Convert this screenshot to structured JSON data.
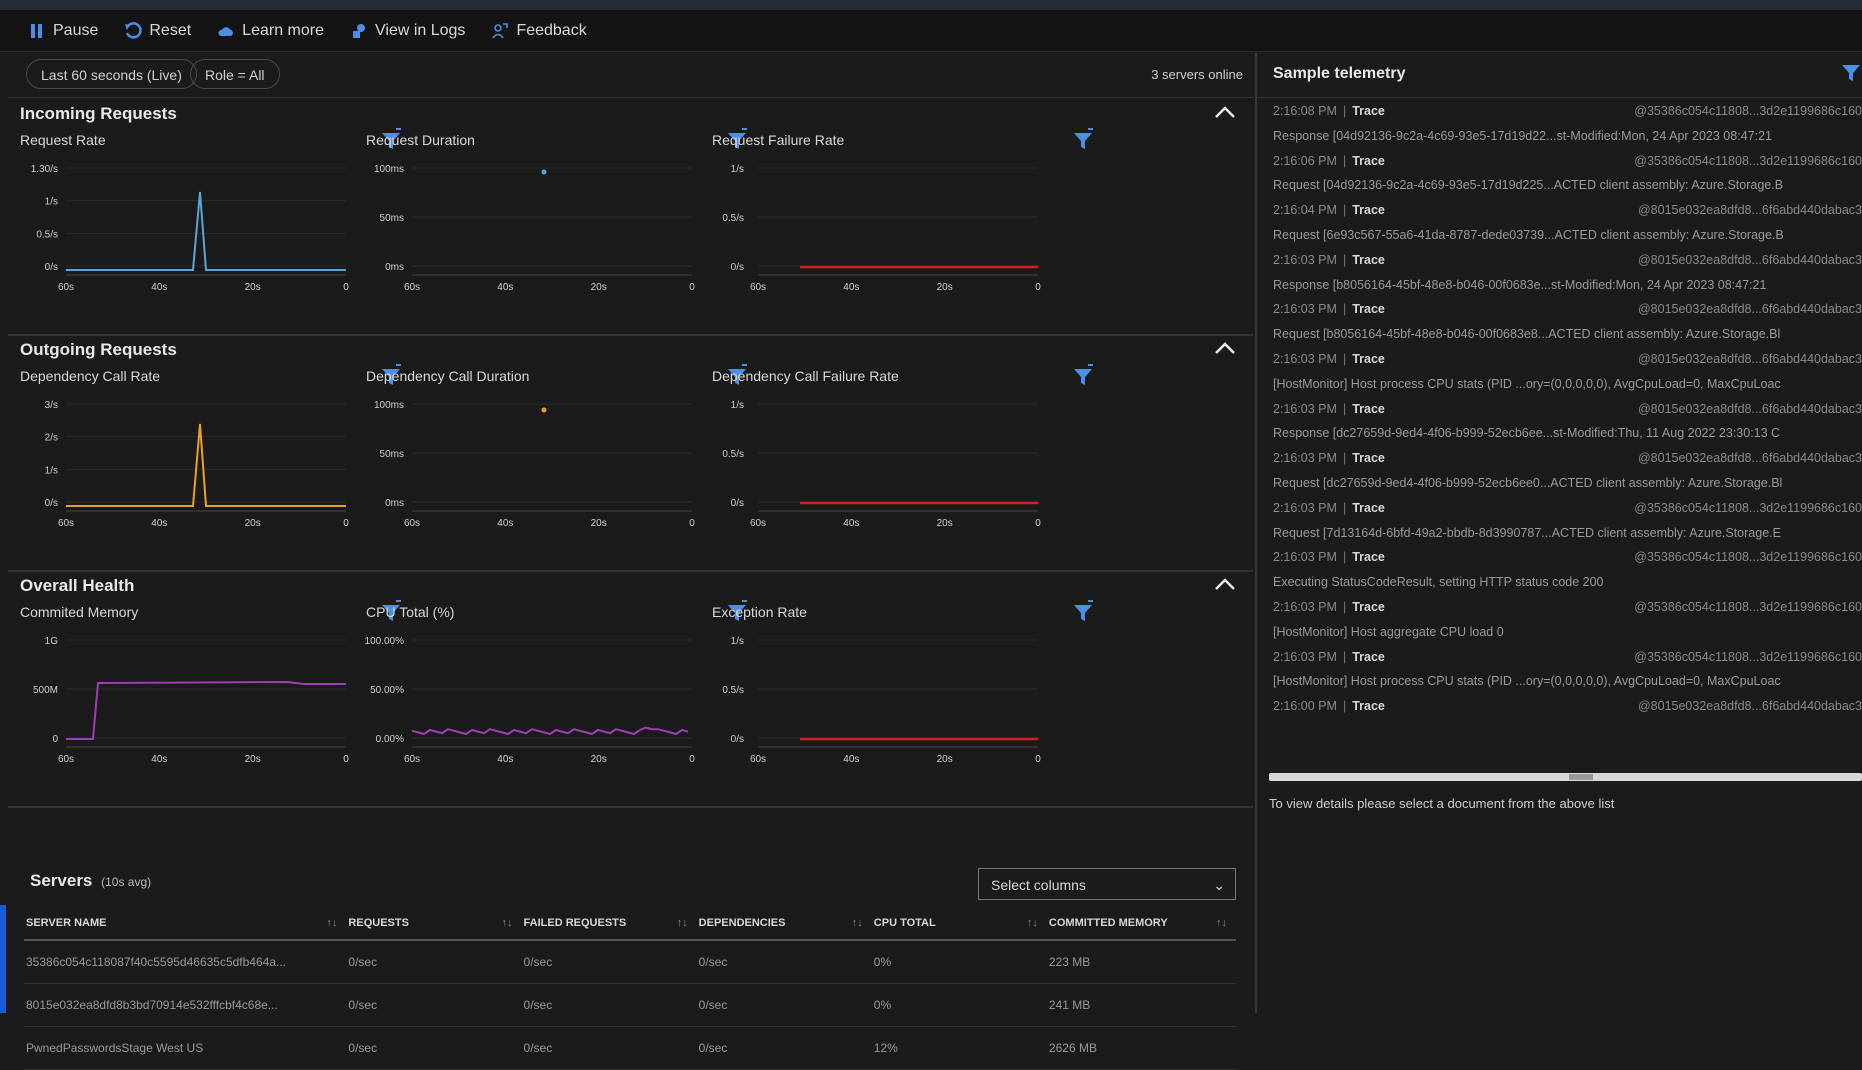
{
  "toolbar": {
    "pause": "Pause",
    "reset": "Reset",
    "learn_more": "Learn more",
    "view_in_logs": "View in Logs",
    "feedback": "Feedback"
  },
  "filters": {
    "time_range": "Last 60 seconds (Live)",
    "role": "Role = All",
    "servers_online": "3 servers online"
  },
  "colors": {
    "request_line": "#5ba6d8",
    "dependency_line": "#e8a12a",
    "memory_line": "#a23bb5",
    "failure_line": "#d62020",
    "filter_icon": "#4d8fe8"
  },
  "x_ticks": [
    "60s",
    "40s",
    "20s",
    "0"
  ],
  "sections": [
    {
      "title": "Incoming Requests",
      "charts": [
        {
          "title": "Request Rate",
          "y_ticks": [
            "1.30/s",
            "1/s",
            "0.5/s",
            "0/s"
          ]
        },
        {
          "title": "Request Duration",
          "y_ticks": [
            "100ms",
            "50ms",
            "0ms"
          ]
        },
        {
          "title": "Request Failure Rate",
          "y_ticks": [
            "1/s",
            "0.5/s",
            "0/s"
          ]
        }
      ]
    },
    {
      "title": "Outgoing Requests",
      "charts": [
        {
          "title": "Dependency Call Rate",
          "y_ticks": [
            "3/s",
            "2/s",
            "1/s",
            "0/s"
          ]
        },
        {
          "title": "Dependency Call Duration",
          "y_ticks": [
            "100ms",
            "50ms",
            "0ms"
          ]
        },
        {
          "title": "Dependency Call Failure Rate",
          "y_ticks": [
            "1/s",
            "0.5/s",
            "0/s"
          ]
        }
      ]
    },
    {
      "title": "Overall Health",
      "charts": [
        {
          "title": "Commited Memory",
          "y_ticks": [
            "1G",
            "500M",
            "0"
          ]
        },
        {
          "title": "CPU Total (%)",
          "y_ticks": [
            "100.00%",
            "50.00%",
            "0.00%"
          ]
        },
        {
          "title": "Exception Rate",
          "y_ticks": [
            "1/s",
            "0.5/s",
            "0/s"
          ]
        }
      ]
    }
  ],
  "servers": {
    "title": "Servers",
    "subtitle": "(10s avg)",
    "select_columns": "Select columns",
    "columns": [
      "SERVER NAME",
      "REQUESTS",
      "FAILED REQUESTS",
      "DEPENDENCIES",
      "CPU TOTAL",
      "COMMITTED MEMORY"
    ],
    "rows": [
      [
        "35386c054c118087f40c5595d46635c5dfb464a...",
        "0/sec",
        "0/sec",
        "0/sec",
        "0%",
        "223 MB"
      ],
      [
        "8015e032ea8dfd8b3bd70914e532fffcbf4c68e...",
        "0/sec",
        "0/sec",
        "0/sec",
        "0%",
        "241 MB"
      ],
      [
        "PwnedPasswordsStage West US",
        "0/sec",
        "0/sec",
        "0/sec",
        "12%",
        "2626 MB"
      ]
    ]
  },
  "telemetry": {
    "title": "Sample telemetry",
    "hint": "To view details please select a document from the above list",
    "items": [
      {
        "time": "2:16:08 PM",
        "type": "Trace",
        "instance": "@35386c054c11808...3d2e1199686c160",
        "message": "Response [04d92136-9c2a-4c69-93e5-17d19d22...st-Modified:Mon, 24 Apr 2023 08:47:21"
      },
      {
        "time": "2:16:06 PM",
        "type": "Trace",
        "instance": "@35386c054c11808...3d2e1199686c160",
        "message": "Request [04d92136-9c2a-4c69-93e5-17d19d225...ACTED client assembly: Azure.Storage.B"
      },
      {
        "time": "2:16:04 PM",
        "type": "Trace",
        "instance": "@8015e032ea8dfd8...6f6abd440dabac3",
        "message": "Request [6e93c567-55a6-41da-8787-dede03739...ACTED client assembly: Azure.Storage.B"
      },
      {
        "time": "2:16:03 PM",
        "type": "Trace",
        "instance": "@8015e032ea8dfd8...6f6abd440dabac3",
        "message": "Response [b8056164-45bf-48e8-b046-00f0683e...st-Modified:Mon, 24 Apr 2023 08:47:21"
      },
      {
        "time": "2:16:03 PM",
        "type": "Trace",
        "instance": "@8015e032ea8dfd8...6f6abd440dabac3",
        "message": "Request [b8056164-45bf-48e8-b046-00f0683e8...ACTED client assembly: Azure.Storage.Bl"
      },
      {
        "time": "2:16:03 PM",
        "type": "Trace",
        "instance": "@8015e032ea8dfd8...6f6abd440dabac3",
        "message": "[HostMonitor] Host process CPU stats (PID ...ory=(0,0,0,0,0), AvgCpuLoad=0, MaxCpuLoac"
      },
      {
        "time": "2:16:03 PM",
        "type": "Trace",
        "instance": "@8015e032ea8dfd8...6f6abd440dabac3",
        "message": "Response [dc27659d-9ed4-4f06-b999-52ecb6ee...st-Modified:Thu, 11 Aug 2022 23:30:13 C"
      },
      {
        "time": "2:16:03 PM",
        "type": "Trace",
        "instance": "@8015e032ea8dfd8...6f6abd440dabac3",
        "message": "Request [dc27659d-9ed4-4f06-b999-52ecb6ee0...ACTED client assembly: Azure.Storage.Bl"
      },
      {
        "time": "2:16:03 PM",
        "type": "Trace",
        "instance": "@35386c054c11808...3d2e1199686c160",
        "message": "Request [7d13164d-6bfd-49a2-bbdb-8d3990787...ACTED client assembly: Azure.Storage.E"
      },
      {
        "time": "2:16:03 PM",
        "type": "Trace",
        "instance": "@35386c054c11808...3d2e1199686c160",
        "message": "Executing StatusCodeResult, setting HTTP status code 200"
      },
      {
        "time": "2:16:03 PM",
        "type": "Trace",
        "instance": "@35386c054c11808...3d2e1199686c160",
        "message": "[HostMonitor] Host aggregate CPU load 0"
      },
      {
        "time": "2:16:03 PM",
        "type": "Trace",
        "instance": "@35386c054c11808...3d2e1199686c160",
        "message": "[HostMonitor] Host process CPU stats (PID ...ory=(0,0,0,0,0), AvgCpuLoad=0, MaxCpuLoac"
      },
      {
        "time": "2:16:00 PM",
        "type": "Trace",
        "instance": "@8015e032ea8dfd8...6f6abd440dabac3",
        "message": ""
      }
    ]
  }
}
